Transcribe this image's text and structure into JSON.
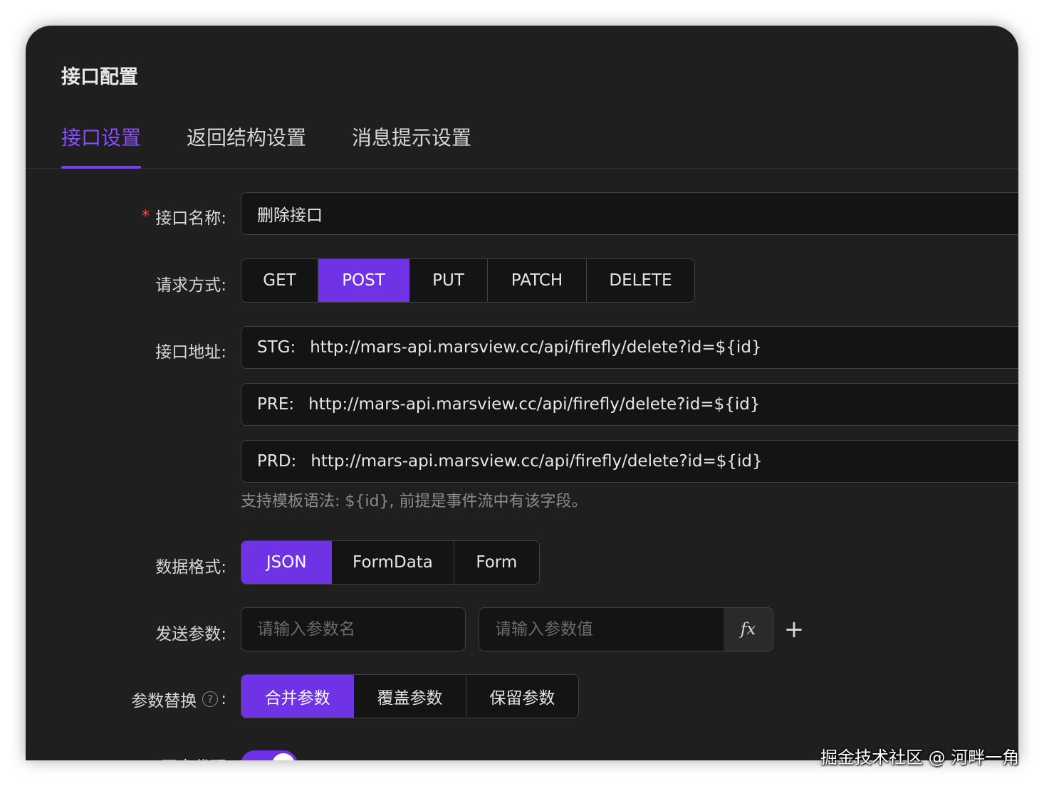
{
  "header": {
    "title": "接口配置"
  },
  "tabs": [
    {
      "label": "接口设置",
      "active": true
    },
    {
      "label": "返回结构设置",
      "active": false
    },
    {
      "label": "消息提示设置",
      "active": false
    }
  ],
  "form": {
    "name": {
      "label": "接口名称:",
      "required_mark": "*",
      "value": "删除接口"
    },
    "method": {
      "label": "请求方式:",
      "options": [
        "GET",
        "POST",
        "PUT",
        "PATCH",
        "DELETE"
      ],
      "selected": "POST"
    },
    "address": {
      "label": "接口地址:",
      "envs": [
        {
          "prefix": "STG:",
          "url": "http://mars-api.marsview.cc/api/firefly/delete?id=${id}"
        },
        {
          "prefix": "PRE:",
          "url": "http://mars-api.marsview.cc/api/firefly/delete?id=${id}"
        },
        {
          "prefix": "PRD:",
          "url": "http://mars-api.marsview.cc/api/firefly/delete?id=${id}"
        }
      ],
      "hint": "支持模板语法: ${id}, 前提是事件流中有该字段。"
    },
    "format": {
      "label": "数据格式:",
      "options": [
        "JSON",
        "FormData",
        "Form"
      ],
      "selected": "JSON"
    },
    "params": {
      "label": "发送参数:",
      "name_placeholder": "请输入参数名",
      "value_placeholder": "请输入参数值",
      "fx_label": "fx",
      "add_label": "+"
    },
    "replace": {
      "label": "参数替换",
      "help": "?",
      "colon": ":",
      "options": [
        "合并参数",
        "覆盖参数",
        "保留参数"
      ],
      "selected": "合并参数"
    },
    "proxy": {
      "label": "开启代理",
      "enabled": true
    }
  },
  "watermark": "掘金技术社区 @ 河畔一角",
  "colors": {
    "accent": "#6f33e5",
    "accent_text": "#8a4dff",
    "background": "#1f1f1f",
    "input_bg": "#141414",
    "border": "#424242"
  }
}
